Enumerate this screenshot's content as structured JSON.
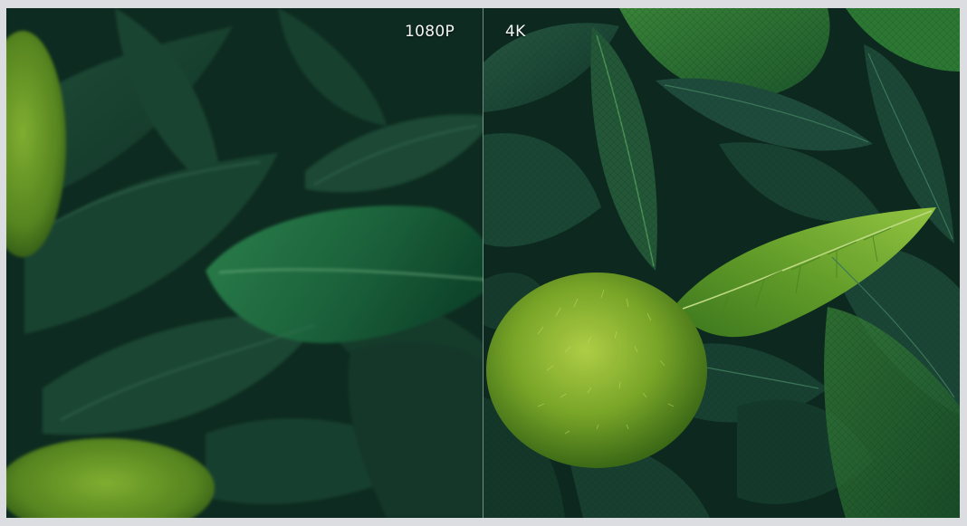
{
  "comparison": {
    "left_label": "1080P",
    "right_label": "4K"
  },
  "colors": {
    "dark_leaf": "#1b4a37",
    "mid_leaf": "#236a45",
    "bright_leaf": "#5c9e2c",
    "moss": "#7fae2a",
    "shadow": "#0a1f17"
  }
}
